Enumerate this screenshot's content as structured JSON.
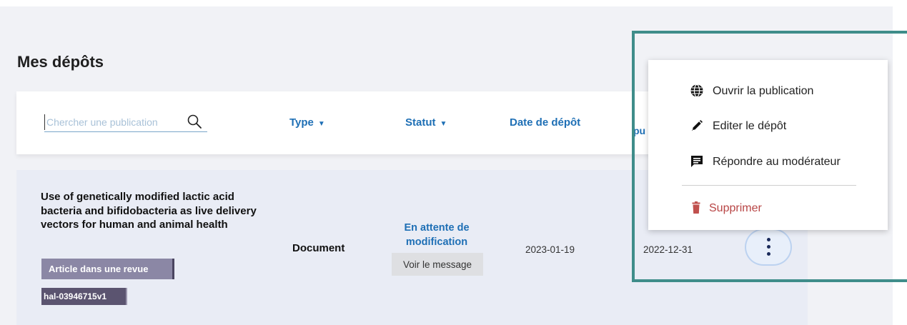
{
  "page": {
    "title": "Mes dépôts"
  },
  "search": {
    "placeholder": "Chercher une publication"
  },
  "columns": {
    "type": "Type",
    "status": "Statut",
    "deposit_date": "Date de dépôt",
    "next_cut": "pu"
  },
  "rows": [
    {
      "title": "Use of genetically modified lactic acid bacteria and bifidobacteria as live delivery vectors for human and animal health",
      "doc_type_badge": "Article dans une revue",
      "hal_id": "hal-03946715v1",
      "type": "Document",
      "status": "En attente de modification",
      "message_button": "Voir le message",
      "deposit_date": "2023-01-19",
      "publication_date": "2022-12-31"
    }
  ],
  "menu": {
    "items": [
      {
        "label": "Ouvrir la publication",
        "icon": "globe-icon"
      },
      {
        "label": "Editer le dépôt",
        "icon": "pencil-icon"
      },
      {
        "label": "Répondre au modérateur",
        "icon": "comment-icon"
      }
    ],
    "delete": {
      "label": "Supprimer",
      "icon": "trash-icon"
    }
  },
  "colors": {
    "accent": "#1e6fb5",
    "highlight_border": "#3f8d8a",
    "danger": "#b84545",
    "row_background": "#e9ecf5"
  }
}
